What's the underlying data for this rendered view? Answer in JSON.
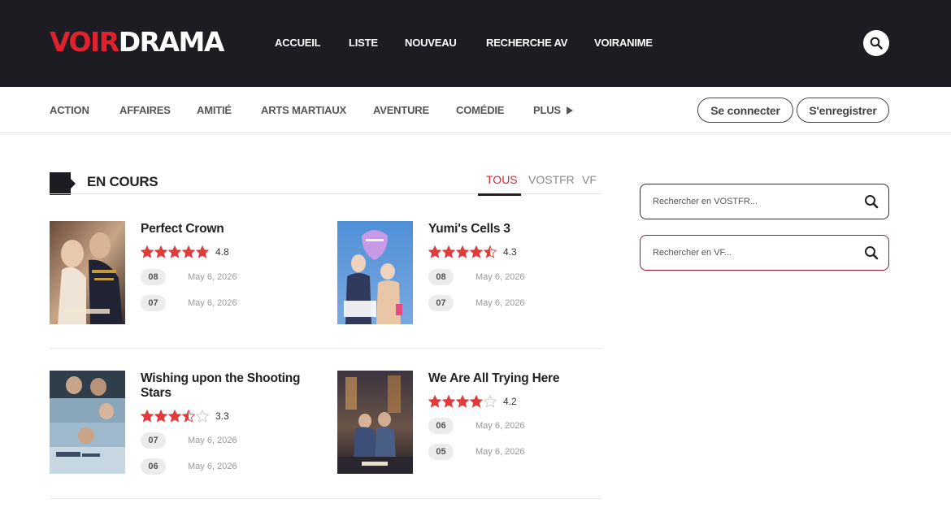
{
  "header": {
    "logo_part1": "VOIR",
    "logo_part2": "DRAMA",
    "nav": [
      "ACCUEIL",
      "LISTE",
      "NOUVEAU",
      "RECHERCHE AV",
      "VOIRANIME"
    ]
  },
  "genres": [
    "ACTION",
    "AFFAIRES",
    "AMITIÉ",
    "ARTS MARTIAUX",
    "AVENTURE",
    "COMÉDIE"
  ],
  "more_label": "PLUS",
  "auth": {
    "login": "Se connecter",
    "register": "S'enregistrer"
  },
  "section": {
    "title": "EN COURS",
    "tabs": [
      "TOUS",
      "VOSTFR",
      "VF"
    ],
    "active_tab": "TOUS"
  },
  "dramas": [
    {
      "title": "Perfect Crown",
      "rating": 4.8,
      "rating_label": "4.8",
      "episodes": [
        {
          "ep": "08",
          "date": "May 6, 2026"
        },
        {
          "ep": "07",
          "date": "May 6, 2026"
        }
      ]
    },
    {
      "title": "Yumi's Cells 3",
      "rating": 4.3,
      "rating_label": "4.3",
      "episodes": [
        {
          "ep": "08",
          "date": "May 6, 2026"
        },
        {
          "ep": "07",
          "date": "May 6, 2026"
        }
      ]
    },
    {
      "title": "Wishing upon the Shooting Stars",
      "rating": 3.3,
      "rating_label": "3.3",
      "episodes": [
        {
          "ep": "07",
          "date": "May 6, 2026"
        },
        {
          "ep": "06",
          "date": "May 6, 2026"
        }
      ]
    },
    {
      "title": "We Are All Trying Here",
      "rating": 4.2,
      "rating_label": "4.2",
      "episodes": [
        {
          "ep": "06",
          "date": "May 6, 2026"
        },
        {
          "ep": "05",
          "date": "May 6, 2026"
        }
      ]
    }
  ],
  "sidebar": {
    "search_vostfr_placeholder": "Rechercher en VOSTFR...",
    "search_vf_placeholder": "Rechercher en VF..."
  },
  "colors": {
    "brand_red": "#e0222f",
    "header_bg": "#1d1c23",
    "star": "#e03a3a",
    "vf_border": "#a01c2c"
  }
}
